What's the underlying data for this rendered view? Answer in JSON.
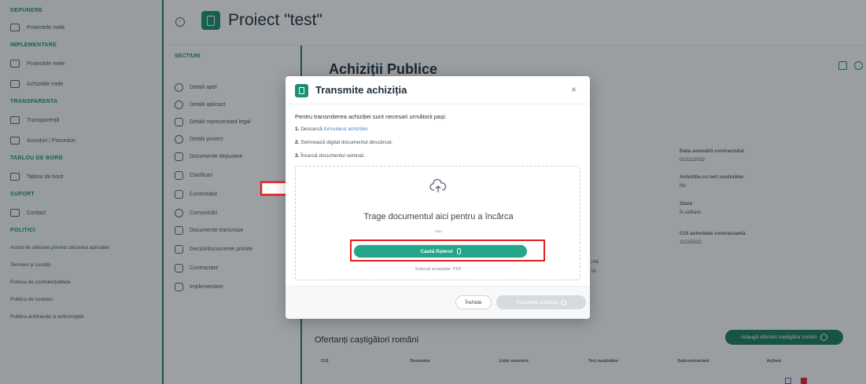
{
  "sidebar": {
    "sections": [
      {
        "title": "DEPUNERE",
        "items": [
          {
            "label": "Proiectele mele",
            "icon": "document-icon"
          }
        ]
      },
      {
        "title": "IMPLEMENTARE",
        "items": [
          {
            "label": "Proiectele mele",
            "icon": "folder-icon"
          },
          {
            "label": "Achizitiile mele",
            "icon": "document-icon"
          }
        ]
      },
      {
        "title": "TRANSPARENTA",
        "items": [
          {
            "label": "Transparență",
            "icon": "table-icon"
          },
          {
            "label": "Anunțuri / Proceduri",
            "icon": "megaphone-icon"
          }
        ]
      },
      {
        "title": "TABLOU DE BORD",
        "items": [
          {
            "label": "Tablou de bord",
            "icon": "monitor-icon"
          }
        ]
      },
      {
        "title": "SUPORT",
        "items": [
          {
            "label": "Contact",
            "icon": "mail-icon"
          }
        ]
      },
      {
        "title": "POLITICI",
        "links": [
          "Acord de utilizare privind utilizarea aplicației",
          "Termeni și condiții",
          "Politica de confidențialitate",
          "Politica de cookies",
          "Politica antifrauda și anticorupție"
        ]
      }
    ]
  },
  "header": {
    "title": "Proiect \"test\""
  },
  "sections_panel": {
    "title": "SECTIUNI",
    "items": [
      "Detalii apel",
      "Detalii aplicant",
      "Detalii reprezentant legal",
      "Detalii proiect",
      "Documente depunere",
      "Clarificari",
      "Contestatie",
      "Comunicări",
      "Documente transmise",
      "Decizii/documente primite",
      "Contractare",
      "Implementare"
    ]
  },
  "main": {
    "card_title": "Achiziții Publice",
    "details": [
      {
        "label": "Data semnării contractului",
        "value": "01/11/2022"
      },
      {
        "label": "Achiziția cu terț susținător",
        "value": "Nu"
      },
      {
        "label": "Stare",
        "value": "În editare"
      },
      {
        "label": "CUI autoritate contractantă",
        "value": "11125522"
      }
    ],
    "mid_fragments": [
      "ntă",
      "IA"
    ],
    "ofertanti_title": "Ofertanți caștigători români",
    "add_button": "Adaugă ofertant caștigător român",
    "table_headers": [
      "CUI",
      "Denumire",
      "Lider asociere",
      "Terț susținător",
      "Subcontractant",
      "Acțiuni"
    ]
  },
  "modal": {
    "title": "Transmite achiziția",
    "close": "×",
    "intro": "Pentru transmiterea achiziției sunt necesari următorii pași:",
    "steps": [
      {
        "num": "1.",
        "text": "Descarcă ",
        "link": "formularul achiziției"
      },
      {
        "num": "2.",
        "text": "Semnează digital documentul descărcat.",
        "link": ""
      },
      {
        "num": "3.",
        "text": "Încarcă documentul semnat.",
        "link": ""
      }
    ],
    "dropzone": {
      "text": "Trage documentul aici pentru a încărca",
      "or": "sau",
      "browse_button": "Caută fișierul",
      "extensions": "Extensii acceptate: PDF"
    },
    "footer": {
      "close_button": "Închide",
      "send_button": "Transmite achiziția"
    }
  },
  "colors": {
    "accent": "#1d8f71",
    "highlight": "#e02020",
    "overlay": "rgba(20,28,36,0.42)"
  }
}
